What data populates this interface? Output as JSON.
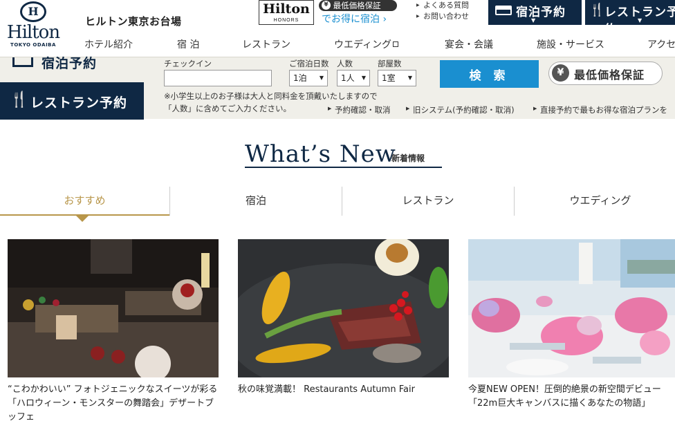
{
  "header": {
    "logo_word": "Hilton",
    "logo_sub": "TOKYO ODAIBA",
    "hotel_name": "ヒルトン東京お台場",
    "honors_word": "Hilton",
    "honors_sub": "HONORS",
    "best_rate_mini": "最低価格保証",
    "deal_link": "でお得に宿泊 ›",
    "util_links": [
      "よくある質問",
      "お問い合わせ"
    ],
    "btn_stay": "宿泊予約",
    "btn_restaurant": "レストラン予約"
  },
  "nav": [
    {
      "label": "ホテル紹介"
    },
    {
      "label": "宿 泊"
    },
    {
      "label": "レストラン"
    },
    {
      "label": "ウエディング"
    },
    {
      "label": "宴会・会議"
    },
    {
      "label": "施設・サービス"
    },
    {
      "label": "アクセ"
    }
  ],
  "booking": {
    "stay_label": "宿泊予約",
    "restaurant_label": "レストラン予約",
    "checkin_label": "チェックイン",
    "nights_label": "ご宿泊日数",
    "nights_value": "1泊",
    "people_label": "人数",
    "people_value": "1人",
    "rooms_label": "部屋数",
    "rooms_value": "1室",
    "note_line1": "※小学生以上のお子様は大人と同料金を頂戴いたしますので",
    "note_line2": "「人数」に含めてご入力ください。",
    "links": [
      "予約確認・取消",
      "旧システム(予約確認・取消)",
      "直接予約で最もお得な宿泊プランを"
    ],
    "search_label": "検 索",
    "best_rate_label": "最低価格保証",
    "yen": "¥"
  },
  "whats_new": {
    "title": "What’s New",
    "subtitle": "新着情報",
    "tabs": [
      "おすすめ",
      "宿泊",
      "レストラン",
      "ウエディング"
    ],
    "active_tab": 0
  },
  "cards": [
    {
      "text": "“こわかわいい” フォトジェニックなスイーツが彩る「ハロウィーン・モンスターの舞踏会」デザートブッフェ"
    },
    {
      "text": "秋の味覚満載！ Restaurants Autumn Fair"
    },
    {
      "text": "今夏NEW OPEN！圧倒的絶景の新空間デビュー「22m巨大キャンバスに描くあなたの物語」"
    }
  ],
  "colors": {
    "navy": "#0f2844",
    "accent_blue": "#1a8fd0",
    "gold": "#b8964a",
    "booking_bg": "#f0efe9"
  }
}
